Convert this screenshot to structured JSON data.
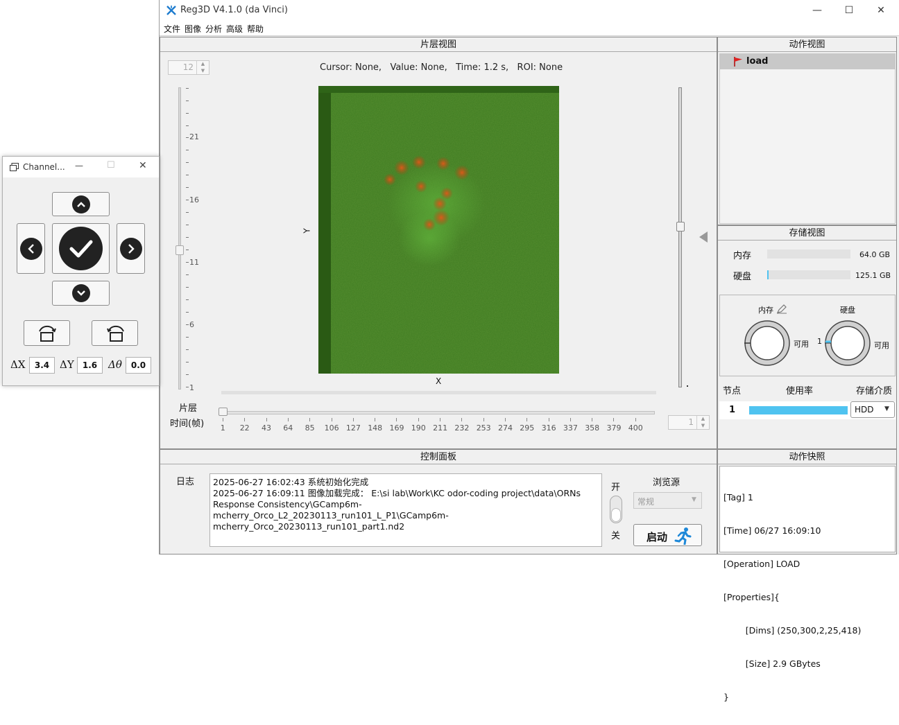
{
  "window": {
    "title": "Reg3D V4.1.0 (da Vinci)",
    "minimize": "—",
    "maximize": "☐",
    "close": "✕"
  },
  "menu": [
    "文件",
    "图像",
    "分析",
    "高级",
    "帮助"
  ],
  "slice_view": {
    "header": "片层视图",
    "status": "Cursor: None,   Value: None,   Time: 1.2 s,   ROI: None",
    "slice_spin": "12",
    "frame_spin": "1",
    "y_label": "Y",
    "x_label": "X",
    "vertical_scale_labels": [
      "21",
      "16",
      "11",
      "6",
      "1"
    ],
    "slice_label": "片层",
    "time_label": "时间(帧)",
    "time_ticks": [
      "1",
      "22",
      "43",
      "64",
      "85",
      "106",
      "127",
      "148",
      "169",
      "190",
      "211",
      "232",
      "253",
      "274",
      "295",
      "316",
      "337",
      "358",
      "379",
      "400"
    ]
  },
  "action_view": {
    "header": "动作视图",
    "items": [
      {
        "label": "load",
        "icon": "red-flag-icon"
      }
    ]
  },
  "storage_view": {
    "header": "存储视图",
    "memory_label": "内存",
    "memory_value": "64.0 GB",
    "memory_fill": 0.0,
    "disk_label": "硬盘",
    "disk_value": "125.1 GB",
    "disk_fill": 0.02,
    "gauge_memory_title": "内存",
    "gauge_disk_title": "硬盘",
    "gauge_available": "可用",
    "gauge_disk_num": "1",
    "table_headers": [
      "节点",
      "使用率",
      "存储介质"
    ],
    "node": "1",
    "usage_fill": 1.0,
    "medium": "HDD"
  },
  "control_panel": {
    "header": "控制面板",
    "log_label": "日志",
    "log_lines": [
      "2025-06-27 16:02:43 系统初始化完成",
      "2025-06-27 16:09:11 图像加载完成：  E:\\si lab\\Work\\KC odor-coding project\\data\\ORNs",
      "Response Consistency\\GCamp6m-",
      "mcherry_Orco_L2_20230113_run101_L_P1\\GCamp6m-",
      "mcherry_Orco_20230113_run101_part1.nd2"
    ],
    "switch_on": "开",
    "switch_off": "关",
    "browse_source_label": "浏览源",
    "browse_source_value": "常规",
    "start_label": "启动"
  },
  "action_snapshot": {
    "header": "动作快照",
    "lines": [
      "[Tag] 1",
      "[Time] 06/27 16:09:10",
      "[Operation] LOAD",
      "[Properties]{",
      "        [Dims] (250,300,2,25,418)",
      "        [Size] 2.9 GBytes",
      "}"
    ]
  },
  "channel_window": {
    "title": "Channel...",
    "minimize": "—",
    "maximize": "☐",
    "close": "✕",
    "dx_label": "ΔX",
    "dx_value": "3.4",
    "dy_label": "ΔY",
    "dy_value": "1.6",
    "dtheta_label": "Δθ",
    "dtheta_value": "0.0"
  },
  "colors": {
    "accent_blue": "#4fc3f0",
    "image_green": "#3f7a1e",
    "flag_red": "#e02020"
  }
}
